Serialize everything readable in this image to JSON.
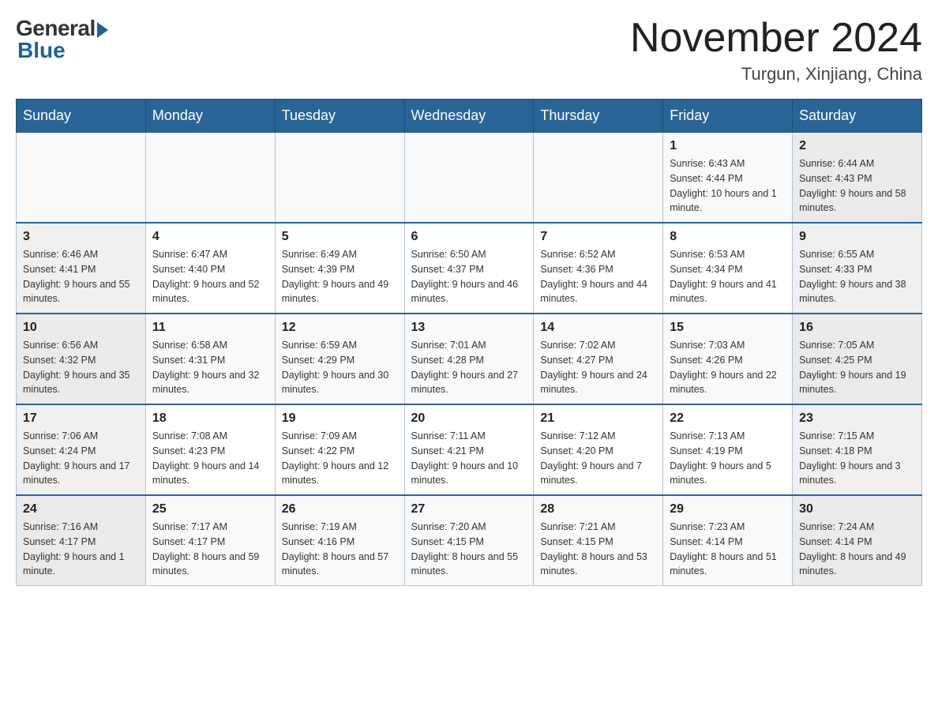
{
  "logo": {
    "general_text": "General",
    "blue_text": "Blue"
  },
  "header": {
    "month_year": "November 2024",
    "location": "Turgun, Xinjiang, China"
  },
  "weekdays": [
    "Sunday",
    "Monday",
    "Tuesday",
    "Wednesday",
    "Thursday",
    "Friday",
    "Saturday"
  ],
  "weeks": [
    [
      {
        "day": "",
        "info": ""
      },
      {
        "day": "",
        "info": ""
      },
      {
        "day": "",
        "info": ""
      },
      {
        "day": "",
        "info": ""
      },
      {
        "day": "",
        "info": ""
      },
      {
        "day": "1",
        "info": "Sunrise: 6:43 AM\nSunset: 4:44 PM\nDaylight: 10 hours and 1 minute."
      },
      {
        "day": "2",
        "info": "Sunrise: 6:44 AM\nSunset: 4:43 PM\nDaylight: 9 hours and 58 minutes."
      }
    ],
    [
      {
        "day": "3",
        "info": "Sunrise: 6:46 AM\nSunset: 4:41 PM\nDaylight: 9 hours and 55 minutes."
      },
      {
        "day": "4",
        "info": "Sunrise: 6:47 AM\nSunset: 4:40 PM\nDaylight: 9 hours and 52 minutes."
      },
      {
        "day": "5",
        "info": "Sunrise: 6:49 AM\nSunset: 4:39 PM\nDaylight: 9 hours and 49 minutes."
      },
      {
        "day": "6",
        "info": "Sunrise: 6:50 AM\nSunset: 4:37 PM\nDaylight: 9 hours and 46 minutes."
      },
      {
        "day": "7",
        "info": "Sunrise: 6:52 AM\nSunset: 4:36 PM\nDaylight: 9 hours and 44 minutes."
      },
      {
        "day": "8",
        "info": "Sunrise: 6:53 AM\nSunset: 4:34 PM\nDaylight: 9 hours and 41 minutes."
      },
      {
        "day": "9",
        "info": "Sunrise: 6:55 AM\nSunset: 4:33 PM\nDaylight: 9 hours and 38 minutes."
      }
    ],
    [
      {
        "day": "10",
        "info": "Sunrise: 6:56 AM\nSunset: 4:32 PM\nDaylight: 9 hours and 35 minutes."
      },
      {
        "day": "11",
        "info": "Sunrise: 6:58 AM\nSunset: 4:31 PM\nDaylight: 9 hours and 32 minutes."
      },
      {
        "day": "12",
        "info": "Sunrise: 6:59 AM\nSunset: 4:29 PM\nDaylight: 9 hours and 30 minutes."
      },
      {
        "day": "13",
        "info": "Sunrise: 7:01 AM\nSunset: 4:28 PM\nDaylight: 9 hours and 27 minutes."
      },
      {
        "day": "14",
        "info": "Sunrise: 7:02 AM\nSunset: 4:27 PM\nDaylight: 9 hours and 24 minutes."
      },
      {
        "day": "15",
        "info": "Sunrise: 7:03 AM\nSunset: 4:26 PM\nDaylight: 9 hours and 22 minutes."
      },
      {
        "day": "16",
        "info": "Sunrise: 7:05 AM\nSunset: 4:25 PM\nDaylight: 9 hours and 19 minutes."
      }
    ],
    [
      {
        "day": "17",
        "info": "Sunrise: 7:06 AM\nSunset: 4:24 PM\nDaylight: 9 hours and 17 minutes."
      },
      {
        "day": "18",
        "info": "Sunrise: 7:08 AM\nSunset: 4:23 PM\nDaylight: 9 hours and 14 minutes."
      },
      {
        "day": "19",
        "info": "Sunrise: 7:09 AM\nSunset: 4:22 PM\nDaylight: 9 hours and 12 minutes."
      },
      {
        "day": "20",
        "info": "Sunrise: 7:11 AM\nSunset: 4:21 PM\nDaylight: 9 hours and 10 minutes."
      },
      {
        "day": "21",
        "info": "Sunrise: 7:12 AM\nSunset: 4:20 PM\nDaylight: 9 hours and 7 minutes."
      },
      {
        "day": "22",
        "info": "Sunrise: 7:13 AM\nSunset: 4:19 PM\nDaylight: 9 hours and 5 minutes."
      },
      {
        "day": "23",
        "info": "Sunrise: 7:15 AM\nSunset: 4:18 PM\nDaylight: 9 hours and 3 minutes."
      }
    ],
    [
      {
        "day": "24",
        "info": "Sunrise: 7:16 AM\nSunset: 4:17 PM\nDaylight: 9 hours and 1 minute."
      },
      {
        "day": "25",
        "info": "Sunrise: 7:17 AM\nSunset: 4:17 PM\nDaylight: 8 hours and 59 minutes."
      },
      {
        "day": "26",
        "info": "Sunrise: 7:19 AM\nSunset: 4:16 PM\nDaylight: 8 hours and 57 minutes."
      },
      {
        "day": "27",
        "info": "Sunrise: 7:20 AM\nSunset: 4:15 PM\nDaylight: 8 hours and 55 minutes."
      },
      {
        "day": "28",
        "info": "Sunrise: 7:21 AM\nSunset: 4:15 PM\nDaylight: 8 hours and 53 minutes."
      },
      {
        "day": "29",
        "info": "Sunrise: 7:23 AM\nSunset: 4:14 PM\nDaylight: 8 hours and 51 minutes."
      },
      {
        "day": "30",
        "info": "Sunrise: 7:24 AM\nSunset: 4:14 PM\nDaylight: 8 hours and 49 minutes."
      }
    ]
  ]
}
